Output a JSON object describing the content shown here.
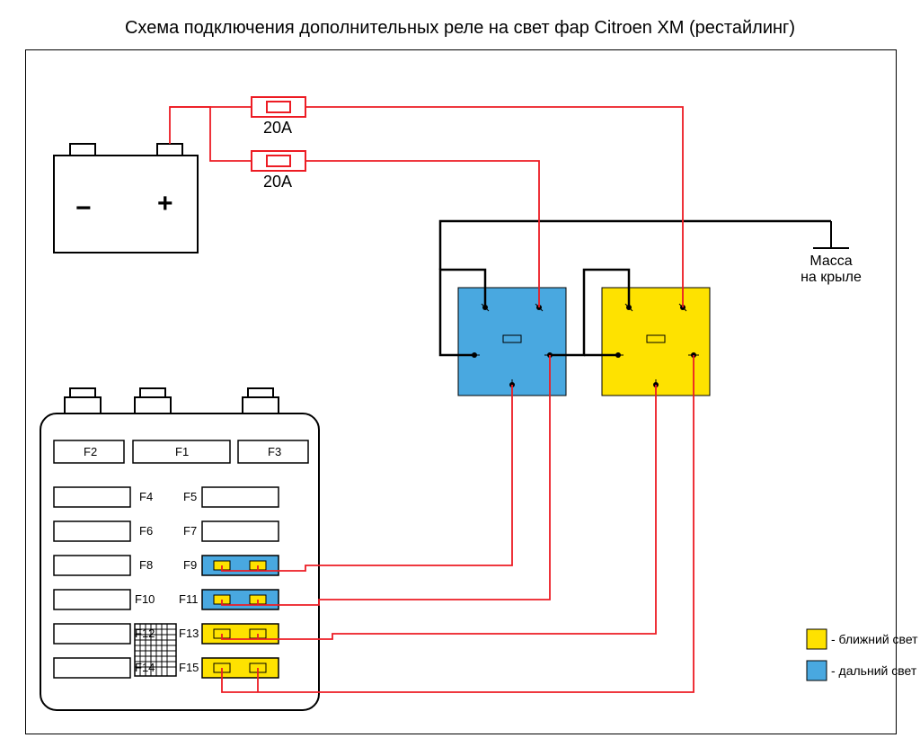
{
  "title": "Схема подключения дополнительных реле на свет фар Citroen XM (рестайлинг)",
  "battery": {
    "minus": "−",
    "plus": "+"
  },
  "fuse1": "20A",
  "fuse2": "20A",
  "mass": {
    "line1": "Масса",
    "line2": "на крыле"
  },
  "fusebox": {
    "F1": "F1",
    "F2": "F2",
    "F3": "F3",
    "F4": "F4",
    "F5": "F5",
    "F6": "F6",
    "F7": "F7",
    "F8": "F8",
    "F9": "F9",
    "F10": "F10",
    "F11": "F11",
    "F12": "F12",
    "F13": "F13",
    "F14": "F14",
    "F15": "F15"
  },
  "legend": {
    "low": "- ближний свет",
    "high": "- дальний свет"
  },
  "colors": {
    "yellow": "#fee200",
    "blue": "#49a8e0",
    "red": "#ed1c24",
    "black": "#000"
  }
}
